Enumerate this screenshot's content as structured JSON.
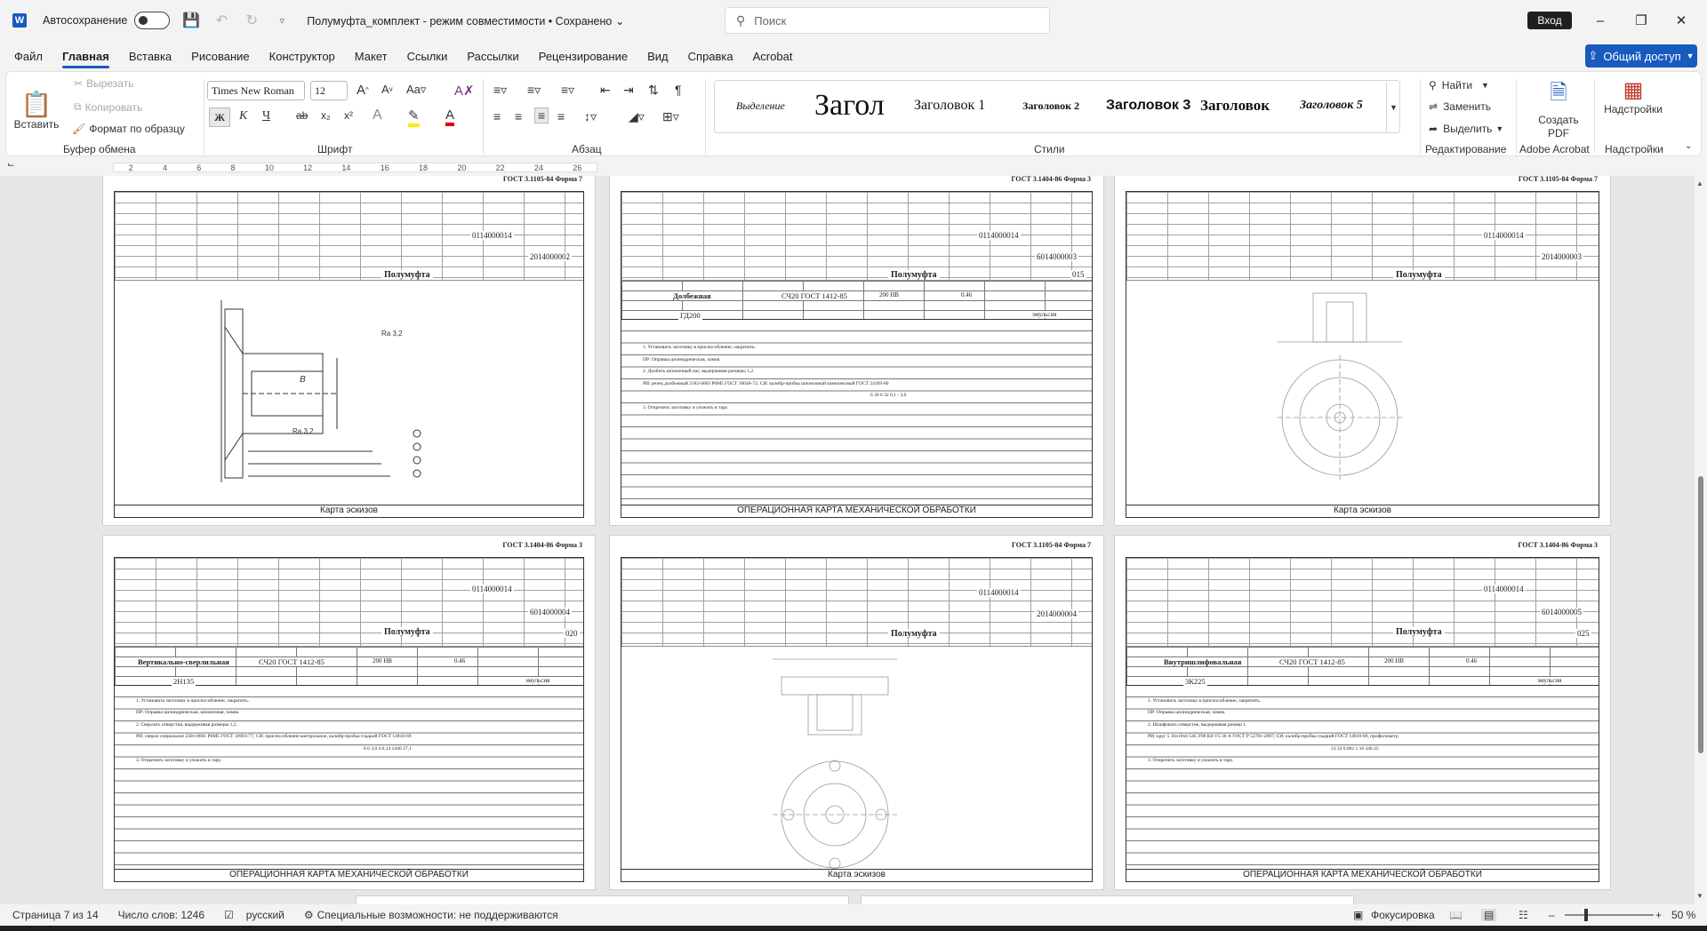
{
  "titlebar": {
    "app_icon": "W",
    "autosave_label": "Автосохранение",
    "doc_title": "Полумуфта_комплект - режим совместимости • Сохранено",
    "search_placeholder": "Поиск",
    "signin_label": "Вход",
    "minimize_icon": "–",
    "restore_icon": "❐",
    "close_icon": "✕"
  },
  "menu": {
    "tabs": [
      "Файл",
      "Главная",
      "Вставка",
      "Рисование",
      "Конструктор",
      "Макет",
      "Ссылки",
      "Рассылки",
      "Рецензирование",
      "Вид",
      "Справка",
      "Acrobat"
    ],
    "share_label": "Общий доступ"
  },
  "ribbon": {
    "clipboard": {
      "paste_label": "Вставить",
      "cut_label": "Вырезать",
      "copy_label": "Копировать",
      "format_painter_label": "Формат по образцу",
      "group_label": "Буфер обмена"
    },
    "font": {
      "font_name": "Times New Roman",
      "font_size": "12",
      "bold": "Ж",
      "italic": "К",
      "underline": "Ч",
      "strike": "ab",
      "subscript": "x₂",
      "superscript": "x²",
      "group_label": "Шрифт"
    },
    "paragraph": {
      "group_label": "Абзац"
    },
    "styles": {
      "items": [
        "Выделение",
        "Загол",
        "Заголовок 1",
        "Заголовок 2",
        "Заголовок 3",
        "Заголовок",
        "Заголовок 5"
      ],
      "group_label": "Стили"
    },
    "editing": {
      "find_label": "Найти",
      "replace_label": "Заменить",
      "select_label": "Выделить",
      "group_label": "Редактирование"
    },
    "acrobat": {
      "create_pdf_label": "Создать PDF",
      "group_label": "Adobe Acrobat"
    },
    "addins": {
      "addins_label": "Надстройки",
      "group_label": "Надстройки"
    }
  },
  "ruler": {
    "ticks": [
      "2",
      "4",
      "6",
      "8",
      "10",
      "12",
      "14",
      "16",
      "18",
      "20",
      "22",
      "24",
      "26"
    ]
  },
  "pages": [
    {
      "gost": "ГОСТ 3.1105-84   Форма 7",
      "doc_code": "0114000014",
      "card_code": "2014000002",
      "part_name": "Полумуфта",
      "footer": "Карта эскизов",
      "sketch_kind": "half-section"
    },
    {
      "gost": "ГОСТ 3.1404-86   Форма 3",
      "doc_code": "0114000014",
      "card_code": "6014000003",
      "part_name": "Полумуфта",
      "op_number": "015",
      "op_name": "Долбежная",
      "material": "СЧ20 ГОСТ 1412-85",
      "hardness": "200 НВ",
      "mass": "0.46",
      "equipment": "ГД200",
      "coolant": "эмульсия",
      "steps": [
        "1. Установить заготовку в приспособление, закрепить.",
        "ПР: Оправка цилиндрическая, хомик",
        "2. Долбить шпоночный паз, выдерживая размеры 1,2.",
        "РИ: резец долбежный 2182-0003 Р6М5 ГОСТ 10046-72; СИ: калибр-пробка шпоночный комплексный ГОСТ 24109-80",
        "6   30   6   32   0,1   -   3,0",
        "3. Открепить заготовку и уложить в тару."
      ],
      "footer": "ОПЕРАЦИОННАЯ КАРТА МЕХАНИЧЕСКОЙ ОБРАБОТКИ"
    },
    {
      "gost": "ГОСТ 3.1105-84   Форма 7",
      "doc_code": "0114000014",
      "card_code": "2014000003",
      "part_name": "Полумуфта",
      "footer": "Карта эскизов",
      "sketch_kind": "wheel"
    },
    {
      "gost": "ГОСТ 3.1404-86   Форма 3",
      "doc_code": "0114000014",
      "card_code": "6014000004",
      "part_name": "Полумуфта",
      "op_number": "020",
      "op_name": "Вертикально-сверлильная",
      "material": "СЧ20 ГОСТ 1412-85",
      "hardness": "200 НВ",
      "mass": "0.46",
      "equipment": "2Н135",
      "coolant": "эмульсия",
      "steps": [
        "1. Установить заготовку в приспособление, закрепить.",
        "ПР: Оправка цилиндрическая, шпоночная, хомик",
        "2. Сверлить отверстия, выдерживая размеры 1,2.",
        "РИ: сверло спиральное 2301-0001 Р6М5 ГОСТ 10903-77; СИ: приспособление контрольное, калибр-пробка гладкий ГОСТ 14810-69",
        "6   6   3,0   4   0,14   1440   27,1",
        "3. Открепить заготовку и уложить в тару."
      ],
      "footer": "ОПЕРАЦИОННАЯ КАРТА МЕХАНИЧЕСКОЙ ОБРАБОТКИ"
    },
    {
      "gost": "ГОСТ 3.1105-84   Форма 7",
      "doc_code": "0114000014",
      "card_code": "2014000004",
      "part_name": "Полумуфта",
      "footer": "Карта эскизов",
      "sketch_kind": "flange"
    },
    {
      "gost": "ГОСТ 3.1404-86   Форма 3",
      "doc_code": "0114000014",
      "card_code": "6014000005",
      "part_name": "Полумуфта",
      "op_number": "025",
      "op_name": "Внутришлифовальная",
      "material": "СЧ20 ГОСТ 1412-85",
      "hardness": "200 НВ",
      "mass": "0.46",
      "equipment": "3К225",
      "coolant": "эмульсия",
      "steps": [
        "1. Установить заготовку в приспособление, закрепить.",
        "ПР: Оправка цилиндрическая, хомик",
        "2. Шлифовать отверстие, выдерживая размер 1.",
        "РИ: круг 5 16х10х6 54С F90 K8 V5 30 А ГОСТ Р 52781-2007; СИ: калибр-пробка гладкий ГОСТ 14810-69, профилометр",
        "23   33   0,002   1   16   346   25",
        "3. Открепить заготовку и уложить в тару."
      ],
      "footer": "ОПЕРАЦИОННАЯ КАРТА МЕХАНИЧЕСКОЙ ОБРАБОТКИ"
    }
  ],
  "status": {
    "page": "Страница 7 из 14",
    "words": "Число слов: 1246",
    "language": "русский",
    "accessibility": "Специальные возможности: не поддерживаются",
    "focus": "Фокусировка",
    "zoom": "50 %"
  }
}
